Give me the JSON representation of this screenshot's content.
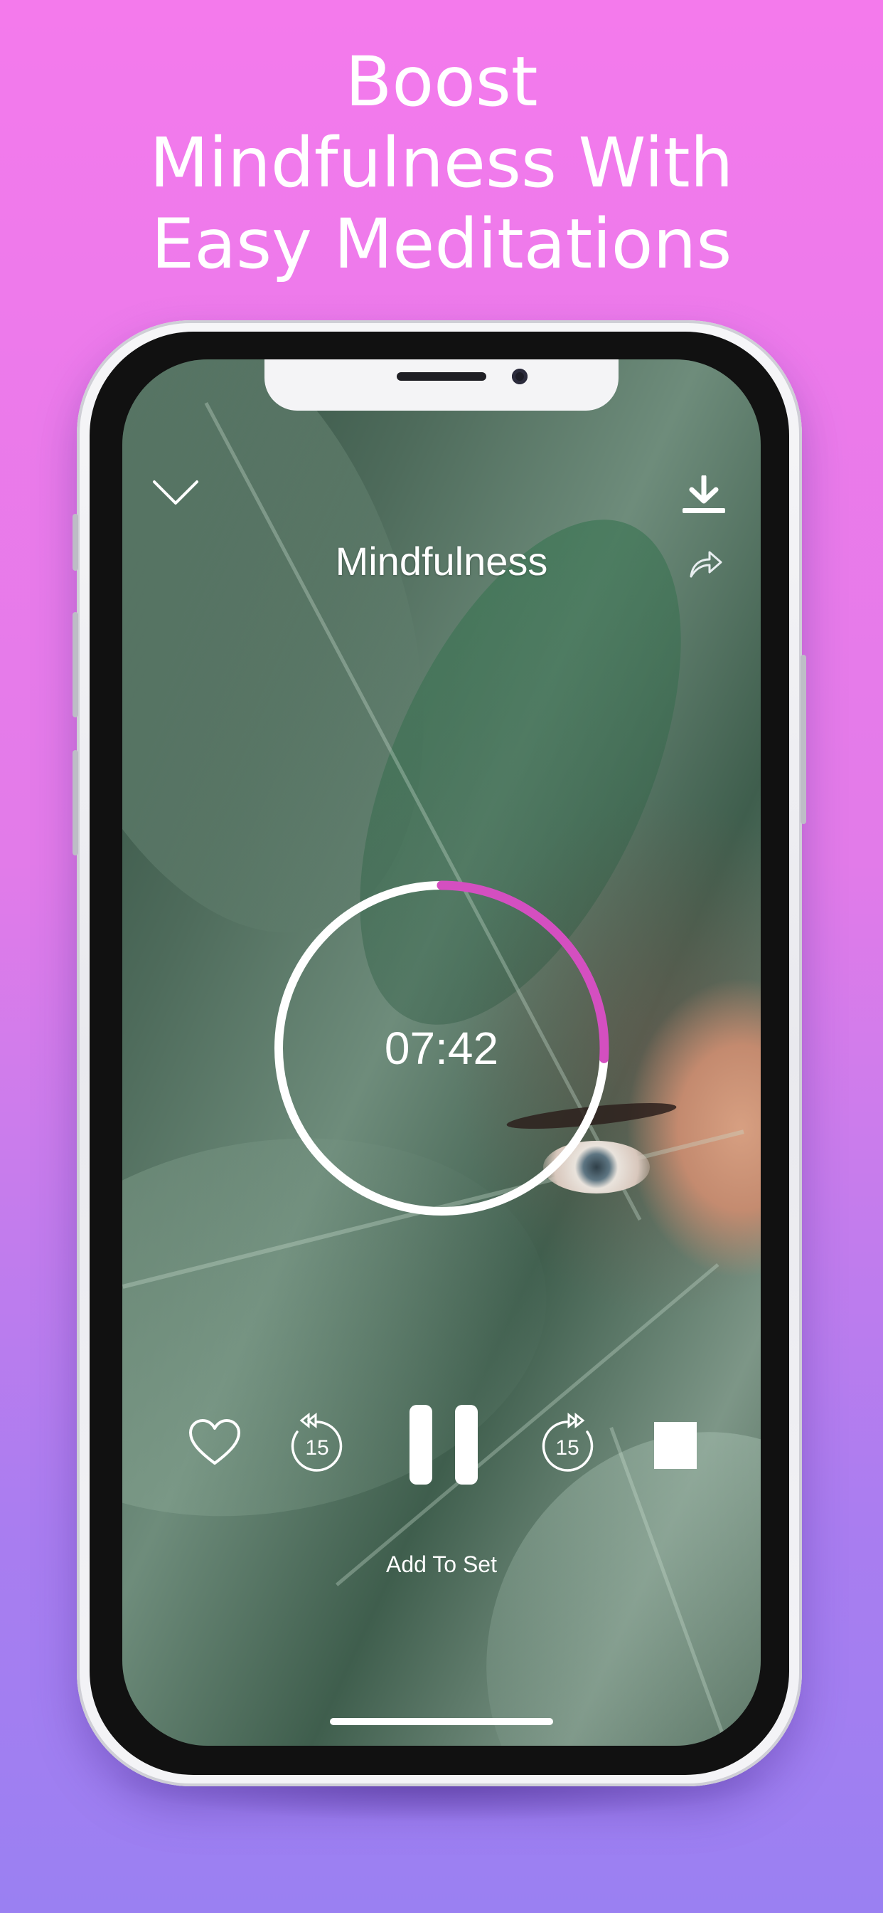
{
  "headline": {
    "line1": "Boost",
    "line2": "Mindfulness With",
    "line3": "Easy Meditations"
  },
  "player": {
    "title": "Mindfulness",
    "time_remaining": "07:42",
    "progress_fraction": 0.26,
    "skip_back_seconds": "15",
    "skip_forward_seconds": "15",
    "add_to_set_label": "Add To Set",
    "accent_color": "#d44fc0"
  },
  "icons": {
    "collapse": "chevron-down-icon",
    "download": "download-icon",
    "share": "share-icon",
    "favorite": "heart-icon",
    "rewind": "rewind-15-icon",
    "play_pause": "pause-icon",
    "forward": "forward-15-icon",
    "stop": "stop-icon"
  }
}
